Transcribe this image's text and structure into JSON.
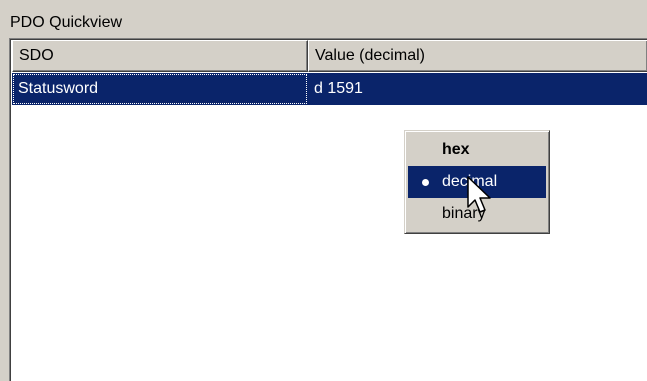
{
  "panel": {
    "title": "PDO Quickview"
  },
  "list": {
    "columns": [
      "SDO",
      "Value (decimal)"
    ],
    "rows": [
      {
        "sdo": "Statusword",
        "value": "d 1591",
        "selected": true
      }
    ]
  },
  "context_menu": {
    "items": [
      {
        "label": "hex",
        "default": true
      },
      {
        "label": "decimal",
        "checked": true,
        "highlighted": true
      },
      {
        "label": "binary"
      }
    ]
  },
  "colors": {
    "selection": "#0a246a",
    "face": "#d4d0c8"
  },
  "icons": {
    "cursor": "hand-pointer-icon",
    "radio": "radio-dot-icon"
  }
}
